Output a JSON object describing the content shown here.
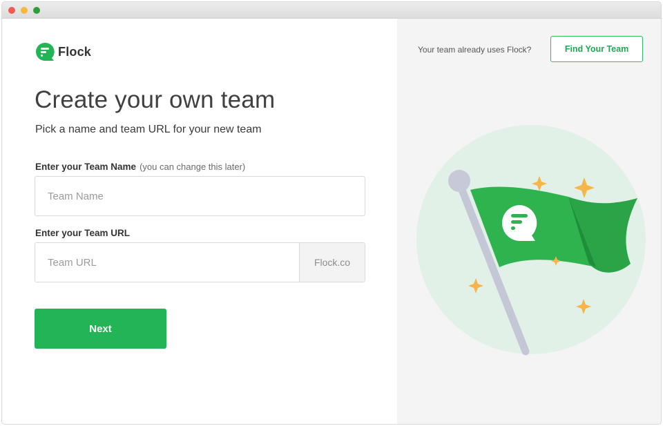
{
  "brand": {
    "name": "Flock",
    "color": "#22b455"
  },
  "main": {
    "title": "Create your own team",
    "subtitle": "Pick a name and team URL for your new team",
    "team_name_label": "Enter your Team Name",
    "team_name_hint": "(you can change this later)",
    "team_name_placeholder": "Team Name",
    "team_name_value": "",
    "team_url_label": "Enter your Team URL",
    "team_url_placeholder": "Team URL",
    "team_url_value": "",
    "team_url_suffix": "Flock.co",
    "next_label": "Next"
  },
  "aside": {
    "already_text": "Your team already uses Flock?",
    "find_team_label": "Find Your Team"
  },
  "colors": {
    "accent": "#22b455",
    "panel_bg": "#f4f4f4",
    "circle_bg": "#e2f1e7",
    "flag_green": "#2eb34f",
    "sparkle": "#f5b54a",
    "pole": "#c5c6d6"
  },
  "icons": [
    "flock-logo-icon",
    "flag-illustration",
    "sparkle-icon"
  ]
}
